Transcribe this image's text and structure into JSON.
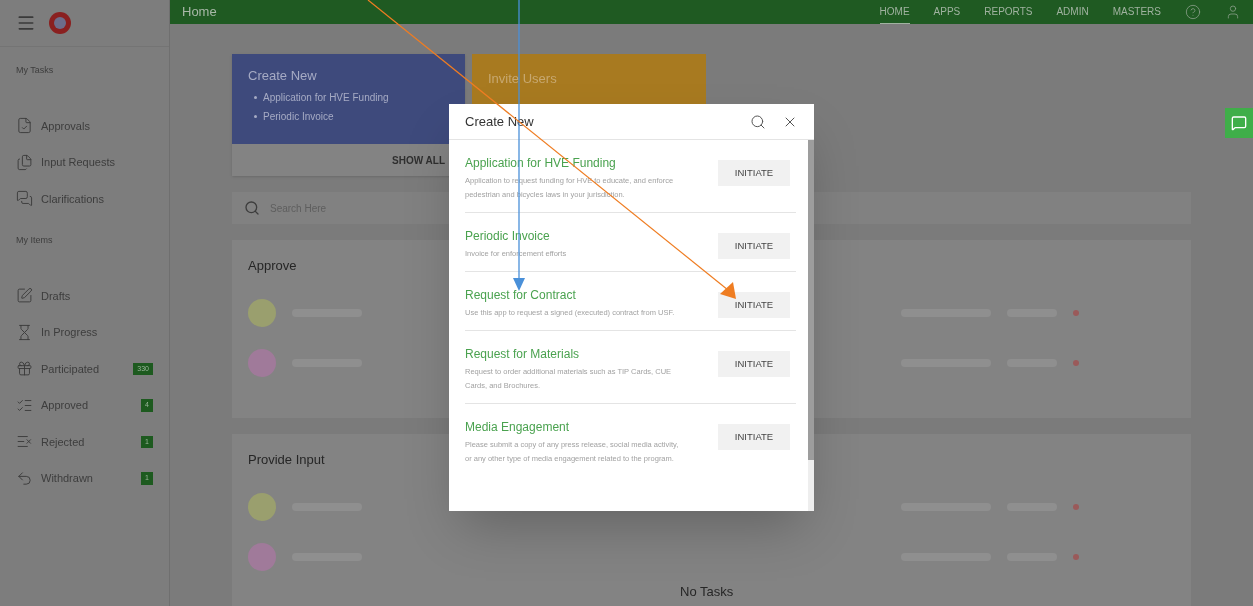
{
  "topbar": {
    "title": "Home",
    "nav": [
      {
        "label": "HOME",
        "selected": true
      },
      {
        "label": "APPS",
        "selected": false
      },
      {
        "label": "REPORTS",
        "selected": false
      },
      {
        "label": "ADMIN",
        "selected": false
      },
      {
        "label": "MASTERS",
        "selected": false
      }
    ]
  },
  "sidebar": {
    "sections": [
      {
        "heading": "My Tasks",
        "items": [
          {
            "label": "Approvals"
          },
          {
            "label": "Input Requests"
          },
          {
            "label": "Clarifications"
          }
        ]
      },
      {
        "heading": "My Items",
        "items": [
          {
            "label": "Drafts"
          },
          {
            "label": "In Progress"
          },
          {
            "label": "Participated",
            "count": "330"
          },
          {
            "label": "Approved",
            "count": "4"
          },
          {
            "label": "Rejected",
            "count": "1"
          },
          {
            "label": "Withdrawn",
            "count": "1"
          }
        ]
      }
    ]
  },
  "create_card": {
    "title": "Create New",
    "items": [
      "Application for HVE Funding",
      "Periodic Invoice"
    ],
    "footer": "SHOW ALL"
  },
  "invite_card": {
    "title": "Invite Users"
  },
  "search": {
    "placeholder": "Search Here"
  },
  "sections": [
    {
      "title": "Approve"
    },
    {
      "title": "Provide Input"
    }
  ],
  "no_tasks": "No Tasks",
  "modal": {
    "title": "Create New",
    "apps": [
      {
        "name": "Application for HVE Funding",
        "description": "Application to request funding for HVE to educate, and enforce pedestrian and bicycles laws in your jurisdiction.",
        "action": "INITIATE"
      },
      {
        "name": "Periodic Invoice",
        "description": "Invoice for enforcement efforts",
        "action": "INITIATE"
      },
      {
        "name": "Request for Contract",
        "description": "Use this app to request a signed (executed) contract from USF.",
        "action": "INITIATE"
      },
      {
        "name": "Request for Materials",
        "description": "Request to order additional materials such as TIP Cards, CUE Cards, and Brochures.",
        "action": "INITIATE"
      },
      {
        "name": "Media Engagement",
        "description": "Please submit a copy of any press release, social media activity, or any other type of media engagement related to the program.",
        "action": "INITIATE"
      }
    ]
  }
}
